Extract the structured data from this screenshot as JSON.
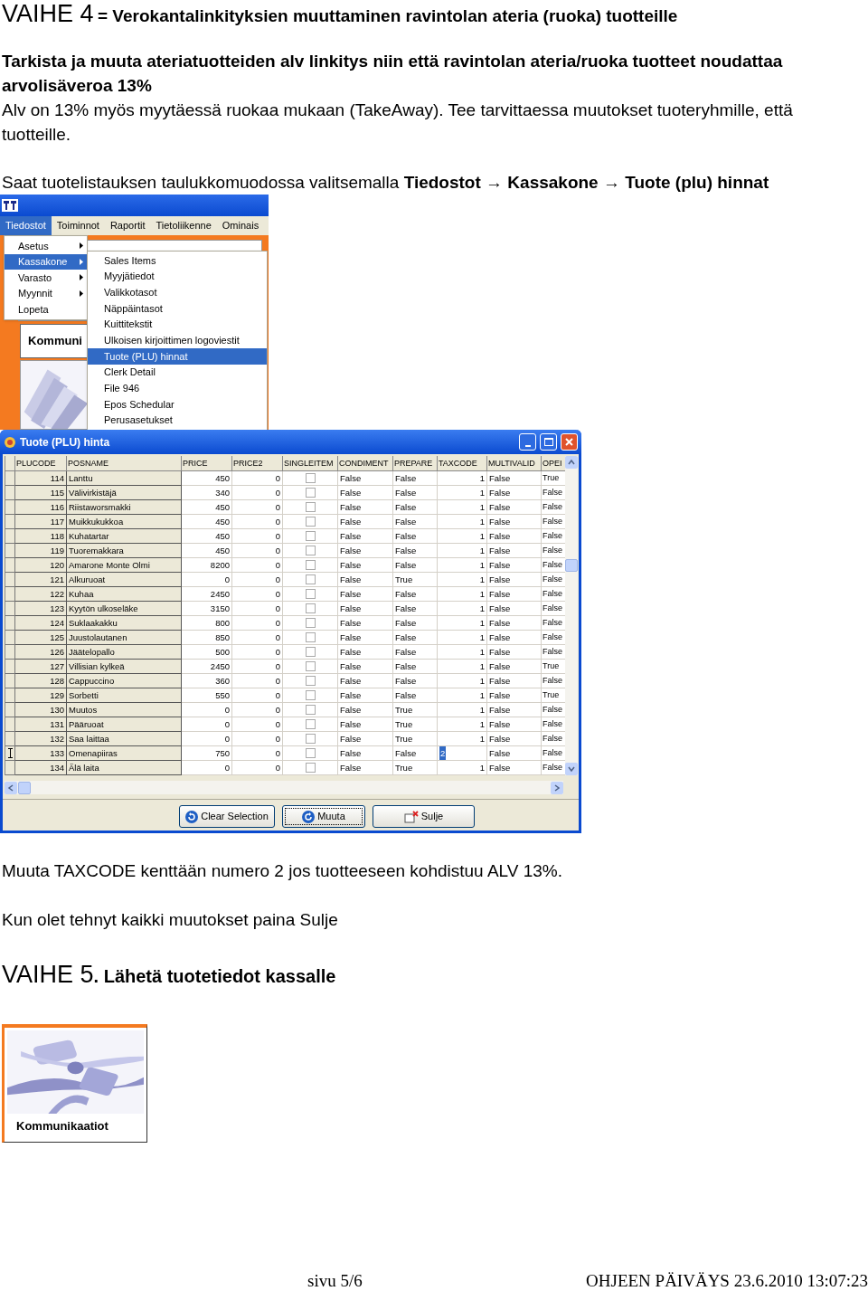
{
  "heading": {
    "step": "VAIHE 4",
    "title": "= Verokantalinkityksien muuttaminen ravintolan ateria (ruoka) tuotteille"
  },
  "intro_bold": "Tarkista ja muuta ateriatuotteiden alv linkitys niin että ravintolan ateria/ruoka tuotteet noudattaa arvolisäveroa 13%",
  "intro": "Alv on 13% myös myytäessä ruokaa mukaan (TakeAway). Tee tarvittaessa muutokset tuoteryhmille, että tuotteille.",
  "instruction": "Saat tuotelistauksen taulukkomuodossa valitsemalla **Tiedostot → Kassakone → Tuote (plu) hinnat**",
  "menu_screenshot": {
    "menubar": [
      {
        "label": "Tiedostot",
        "selected": true
      },
      {
        "label": "Toiminnot",
        "selected": false
      },
      {
        "label": "Raportit",
        "selected": false
      },
      {
        "label": "Tietoliikenne",
        "selected": false
      },
      {
        "label": "Ominais",
        "selected": false
      }
    ],
    "menu": [
      {
        "label": "Asetus",
        "submenu": true,
        "selected": false
      },
      {
        "label": "Kassakone",
        "submenu": true,
        "selected": true
      },
      {
        "label": "Varasto",
        "submenu": true,
        "selected": false
      },
      {
        "label": "Myynnit",
        "submenu": true,
        "selected": false
      },
      {
        "label": "Lopeta",
        "submenu": false,
        "selected": false
      }
    ],
    "submenu": [
      {
        "label": "Sales Items",
        "selected": false
      },
      {
        "label": "Myyjätiedot",
        "selected": false
      },
      {
        "label": "Valikkotasot",
        "selected": false
      },
      {
        "label": "Näppäintasot",
        "selected": false
      },
      {
        "label": "Kuittitekstit",
        "selected": false
      },
      {
        "label": "Ulkoisen kirjoittimen logoviestit",
        "selected": false
      },
      {
        "label": "Tuote (PLU) hinnat",
        "selected": true
      },
      {
        "label": "Clerk Detail",
        "selected": false
      },
      {
        "label": "File 946",
        "selected": false
      },
      {
        "label": "Epos Schedular",
        "selected": false
      },
      {
        "label": "Perusasetukset",
        "selected": false
      }
    ],
    "tile_label": "Kommuni"
  },
  "window": {
    "title": "Tuote (PLU) hinta",
    "columns": [
      "PLUCODE",
      "POSNAME",
      "PRICE",
      "PRICE2",
      "SINGLEITEM",
      "CONDIMENT",
      "PREPARE",
      "TAXCODE",
      "MULTIVALID",
      "OPEI"
    ],
    "rows": [
      {
        "plucode": "114",
        "posname": "Lanttu",
        "price": "450",
        "price2": "0",
        "singleitem": false,
        "condiment": "False",
        "prepare": "False",
        "taxcode": "1",
        "multivalid": "False",
        "opei": "True",
        "selected": false
      },
      {
        "plucode": "115",
        "posname": "Välivirkistäjä",
        "price": "340",
        "price2": "0",
        "singleitem": false,
        "condiment": "False",
        "prepare": "False",
        "taxcode": "1",
        "multivalid": "False",
        "opei": "False",
        "selected": false
      },
      {
        "plucode": "116",
        "posname": "Riistaworsmakki",
        "price": "450",
        "price2": "0",
        "singleitem": false,
        "condiment": "False",
        "prepare": "False",
        "taxcode": "1",
        "multivalid": "False",
        "opei": "False",
        "selected": false
      },
      {
        "plucode": "117",
        "posname": "Muikkukukkoa",
        "price": "450",
        "price2": "0",
        "singleitem": false,
        "condiment": "False",
        "prepare": "False",
        "taxcode": "1",
        "multivalid": "False",
        "opei": "False",
        "selected": false
      },
      {
        "plucode": "118",
        "posname": "Kuhatartar",
        "price": "450",
        "price2": "0",
        "singleitem": false,
        "condiment": "False",
        "prepare": "False",
        "taxcode": "1",
        "multivalid": "False",
        "opei": "False",
        "selected": false
      },
      {
        "plucode": "119",
        "posname": "Tuoremakkara",
        "price": "450",
        "price2": "0",
        "singleitem": false,
        "condiment": "False",
        "prepare": "False",
        "taxcode": "1",
        "multivalid": "False",
        "opei": "False",
        "selected": false
      },
      {
        "plucode": "120",
        "posname": "Amarone Monte Olmi",
        "price": "8200",
        "price2": "0",
        "singleitem": false,
        "condiment": "False",
        "prepare": "False",
        "taxcode": "1",
        "multivalid": "False",
        "opei": "False",
        "selected": false
      },
      {
        "plucode": "121",
        "posname": "Alkuruoat",
        "price": "0",
        "price2": "0",
        "singleitem": false,
        "condiment": "False",
        "prepare": "True",
        "taxcode": "1",
        "multivalid": "False",
        "opei": "False",
        "selected": false
      },
      {
        "plucode": "122",
        "posname": "Kuhaa",
        "price": "2450",
        "price2": "0",
        "singleitem": false,
        "condiment": "False",
        "prepare": "False",
        "taxcode": "1",
        "multivalid": "False",
        "opei": "False",
        "selected": false
      },
      {
        "plucode": "123",
        "posname": "Kyytön ulkoseläke",
        "price": "3150",
        "price2": "0",
        "singleitem": false,
        "condiment": "False",
        "prepare": "False",
        "taxcode": "1",
        "multivalid": "False",
        "opei": "False",
        "selected": false
      },
      {
        "plucode": "124",
        "posname": "Suklaakakku",
        "price": "800",
        "price2": "0",
        "singleitem": false,
        "condiment": "False",
        "prepare": "False",
        "taxcode": "1",
        "multivalid": "False",
        "opei": "False",
        "selected": false
      },
      {
        "plucode": "125",
        "posname": "Juustolautanen",
        "price": "850",
        "price2": "0",
        "singleitem": false,
        "condiment": "False",
        "prepare": "False",
        "taxcode": "1",
        "multivalid": "False",
        "opei": "False",
        "selected": false
      },
      {
        "plucode": "126",
        "posname": "Jäätelopallo",
        "price": "500",
        "price2": "0",
        "singleitem": false,
        "condiment": "False",
        "prepare": "False",
        "taxcode": "1",
        "multivalid": "False",
        "opei": "False",
        "selected": false
      },
      {
        "plucode": "127",
        "posname": "Villisian kylkeä",
        "price": "2450",
        "price2": "0",
        "singleitem": false,
        "condiment": "False",
        "prepare": "False",
        "taxcode": "1",
        "multivalid": "False",
        "opei": "True",
        "selected": false
      },
      {
        "plucode": "128",
        "posname": "Cappuccino",
        "price": "360",
        "price2": "0",
        "singleitem": false,
        "condiment": "False",
        "prepare": "False",
        "taxcode": "1",
        "multivalid": "False",
        "opei": "False",
        "selected": false
      },
      {
        "plucode": "129",
        "posname": "Sorbetti",
        "price": "550",
        "price2": "0",
        "singleitem": false,
        "condiment": "False",
        "prepare": "False",
        "taxcode": "1",
        "multivalid": "False",
        "opei": "True",
        "selected": false
      },
      {
        "plucode": "130",
        "posname": "Muutos",
        "price": "0",
        "price2": "0",
        "singleitem": false,
        "condiment": "False",
        "prepare": "True",
        "taxcode": "1",
        "multivalid": "False",
        "opei": "False",
        "selected": false
      },
      {
        "plucode": "131",
        "posname": "Pääruoat",
        "price": "0",
        "price2": "0",
        "singleitem": false,
        "condiment": "False",
        "prepare": "True",
        "taxcode": "1",
        "multivalid": "False",
        "opei": "False",
        "selected": false
      },
      {
        "plucode": "132",
        "posname": "Saa laittaa",
        "price": "0",
        "price2": "0",
        "singleitem": false,
        "condiment": "False",
        "prepare": "True",
        "taxcode": "1",
        "multivalid": "False",
        "opei": "False",
        "selected": false
      },
      {
        "plucode": "133",
        "posname": "Omenapiiras",
        "price": "750",
        "price2": "0",
        "singleitem": false,
        "condiment": "False",
        "prepare": "False",
        "taxcode": "2",
        "multivalid": "False",
        "opei": "False",
        "selected": true
      },
      {
        "plucode": "134",
        "posname": "Älä laita",
        "price": "0",
        "price2": "0",
        "singleitem": false,
        "condiment": "False",
        "prepare": "True",
        "taxcode": "1",
        "multivalid": "False",
        "opei": "False",
        "selected": false
      }
    ],
    "buttons": [
      {
        "label": "Clear Selection",
        "kind": "clear"
      },
      {
        "label": "Muuta",
        "kind": "change"
      },
      {
        "label": "Sulje",
        "kind": "close"
      }
    ]
  },
  "note_taxcode": "Muuta TAXCODE kenttään numero 2 jos tuotteeseen kohdistuu ALV 13%.",
  "note_close": "Kun olet tehnyt kaikki muutokset paina Sulje",
  "heading2": {
    "step": "VAIHE 5",
    "title": ". Lähetä tuotetiedot kassalle"
  },
  "tile": {
    "label": "Kommunikaatiot"
  },
  "footer": {
    "page": "sivu 5/6",
    "date": "OHJEEN PÄIVÄYS 23.6.2010 13:07:23"
  }
}
